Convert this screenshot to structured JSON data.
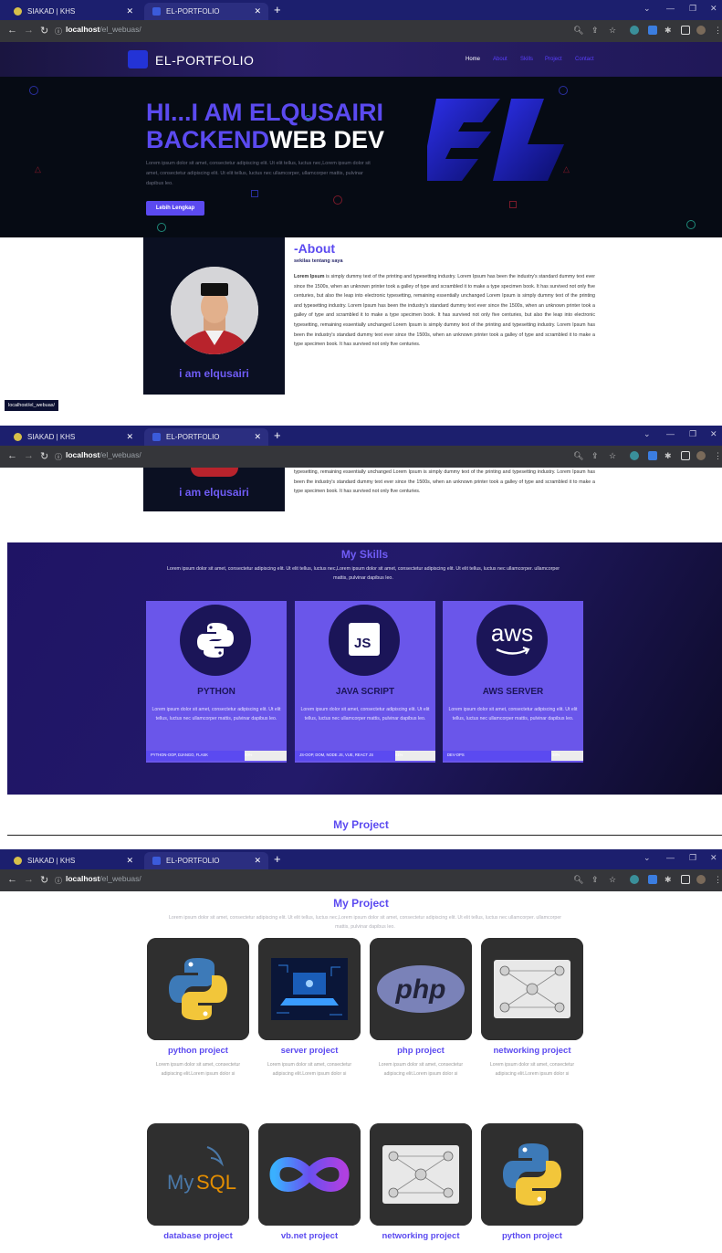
{
  "browser": {
    "tabs": [
      {
        "label": "SIAKAD | KHS"
      },
      {
        "label": "EL-PORTFOLIO"
      }
    ],
    "url_host": "localhost",
    "url_path": "/el_webuas/",
    "status_url": "localhost/el_webuas/"
  },
  "site": {
    "brand": "EL-PORTFOLIO",
    "menu": [
      "Home",
      "About",
      "Skills",
      "Project",
      "Contact"
    ],
    "hero": {
      "line1": "HI...I AM ELQUSAIRI",
      "line2_accent": "BACKEND",
      "line2_white": "WEB DEV",
      "paragraph": "Lorem ipsum dolor sit amet, consectetur adipiscing elit. Ut elit tellus, luctus nec,Lorem ipsum dolor sit amet, consectetur adipiscing elit. Ut elit tellus, luctus nec ullamcorper, ullamcorper mattis, pulvinar dapibus leo.",
      "button": "Lebih Lengkap"
    },
    "about": {
      "name": "i am elqusairi",
      "title": "-About",
      "subtitle": "sekilas tentang saya",
      "paragraph_prefix": "Lorem Ipsum",
      "paragraph": " is simply dummy text of the printing and typesetting industry. Lorem Ipsum has been the industry's standard dummy text ever since the 1500s, when an unknown printer took a galley of type and scrambled it to make a type specimen book. It has survived not only five centuries, but also the leap into electronic typesetting, remaining essentially unchanged Lorem Ipsum is simply dummy text of the printing and typesetting industry. Lorem Ipsum has been the industry's standard dummy text ever since the 1500s, when an unknown printer took a galley of type and scrambled it to make a type specimen book. It has survived not only five centuries, but also the leap into electronic typesetting, remaining essentially unchanged Lorem Ipsum is simply dummy text of the printing and typesetting industry. Lorem Ipsum has been the industry's standard dummy text ever since the 1500s, when an unknown printer took a galley of type and scrambled it to make a type specimen book. It has survived not only five centuries.",
      "paragraph_tail": "typesetting, remaining essentially unchanged Lorem Ipsum is simply dummy text of the printing and typesetting industry. Lorem Ipsum has been the industry's standard dummy text ever since the 1500s, when an unknown printer took a galley of type and scrambled it to make a type specimen book. It has survived not only five centuries."
    },
    "skills": {
      "title": "My Skills",
      "paragraph": "Lorem ipsum dolor sit amet, consectetur adipiscing elit. Ut elit tellus, luctus nec,Lorem ipsum dolor sit amet, consectetur adipiscing elit. Ut elit tellus, luctus nec ullamcorper. ullamcorper mattis, pulvinar dapibus leo.",
      "items": [
        {
          "name": "PYTHON",
          "icon": "python-icon",
          "desc": "Lorem ipsum dolor sit amet, consectetur adipiscing elit. Ut elit tellus, luctus nec ullamcorper mattis, pulvinar dapibus leo.",
          "bar_label": "PYTHON-OOP, DJANGO, FLASK",
          "percent_label": "80%",
          "percent": 80
        },
        {
          "name": "JAVA SCRIPT",
          "icon": "javascript-icon",
          "icon_text": "JS",
          "desc": "Lorem ipsum dolor sit amet, consectetur adipiscing elit. Ut elit tellus, luctus nec ullamcorper mattis, pulvinar dapibus leo.",
          "bar_label": "JS-OOP, DOM, NODE JS, VUE, REACT JS",
          "percent_label": "81%",
          "percent": 81
        },
        {
          "name": "AWS SERVER",
          "icon": "aws-icon",
          "icon_text": "aws",
          "desc": "Lorem ipsum dolor sit amet, consectetur adipiscing elit. Ut elit tellus, luctus nec ullamcorper mattis, pulvinar dapibus leo.",
          "bar_label": "DEV-OPS",
          "percent_label": "88%",
          "percent": 88
        }
      ]
    },
    "projects": {
      "title": "My Project",
      "paragraph": "Lorem ipsum dolor sit amet, consectetur adipiscing elit. Ut elit tellus, luctus nec,Lorem ipsum dolor sit amet, consectetur adipiscing elit. Ut elit tellus, luctus nec ullamcorper. ullamcorper mattis, pulvinar dapibus leo.",
      "items": [
        {
          "name": "python project",
          "image": "python-logo",
          "desc": "Lorem ipsum dolor sit amet, consectetur adipiscing elit.Lorem ipsum dolor si"
        },
        {
          "name": "server project",
          "image": "server-laptop",
          "desc": "Lorem ipsum dolor sit amet, consectetur adipiscing elit.Lorem ipsum dolor si"
        },
        {
          "name": "php project",
          "image": "php-logo",
          "image_text": "php",
          "desc": "Lorem ipsum dolor sit amet, consectetur adipiscing elit.Lorem ipsum dolor si"
        },
        {
          "name": "networking project",
          "image": "network-diagram",
          "desc": "Lorem ipsum dolor sit amet, consectetur adipiscing elit.Lorem ipsum dolor si"
        },
        {
          "name": "database project",
          "image": "mysql-logo",
          "image_text_1": "My",
          "image_text_2": "SQL"
        },
        {
          "name": "vb.net project",
          "image": "infinity-logo"
        },
        {
          "name": "networking project",
          "image": "network-diagram"
        },
        {
          "name": "python project",
          "image": "python-logo"
        }
      ]
    }
  },
  "colors": {
    "accent": "#5b4af0",
    "tabbar": "#1c1f6e",
    "hero_bg": "#060b14",
    "skills_bg": "#1f1465"
  }
}
